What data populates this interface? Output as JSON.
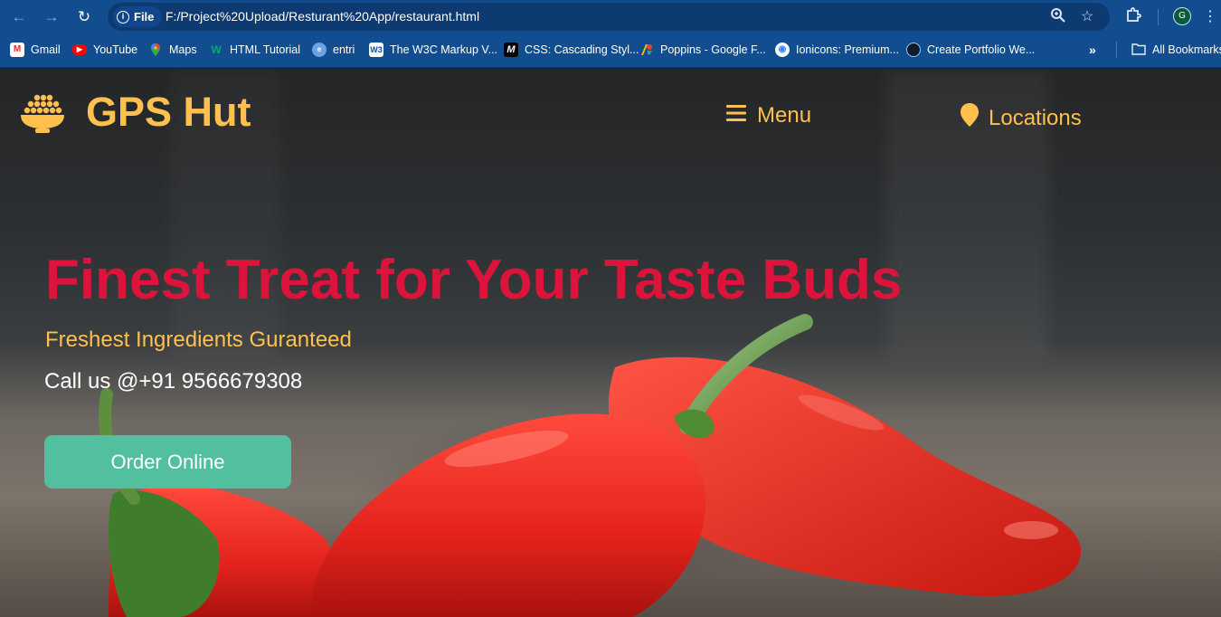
{
  "browser": {
    "url_chip": "File",
    "url": "F:/Project%20Upload/Resturant%20App/restaurant.html",
    "avatar_letter": "G",
    "bookmarks": [
      {
        "label": "Gmail",
        "icon": "gmail-icon"
      },
      {
        "label": "YouTube",
        "icon": "youtube-icon"
      },
      {
        "label": "Maps",
        "icon": "maps-icon"
      },
      {
        "label": "HTML Tutorial",
        "icon": "w3schools-icon"
      },
      {
        "label": "entri",
        "icon": "entri-icon"
      },
      {
        "label": "The W3C Markup V...",
        "icon": "w3c-icon"
      },
      {
        "label": "CSS: Cascading Styl...",
        "icon": "mdn-icon"
      },
      {
        "label": "Poppins - Google F...",
        "icon": "google-fonts-icon"
      },
      {
        "label": "Ionicons: Premium...",
        "icon": "ionicons-icon"
      },
      {
        "label": "Create Portfolio We...",
        "icon": "portfolio-icon"
      }
    ],
    "all_bookmarks": "All Bookmarks"
  },
  "site": {
    "brand": "GPS Hut",
    "nav": {
      "menu": "Menu",
      "locations": "Locations"
    },
    "hero": {
      "title": "Finest Treat for Your Taste Buds",
      "subtitle": "Freshest Ingredients Guranteed",
      "call": "Call us @+91 9566679308",
      "button": "Order Online"
    }
  },
  "colors": {
    "brand_yellow": "#ffc04d",
    "title_red": "#dc143c",
    "button_green": "#52bf9e",
    "browser_blue": "#124d8f"
  }
}
